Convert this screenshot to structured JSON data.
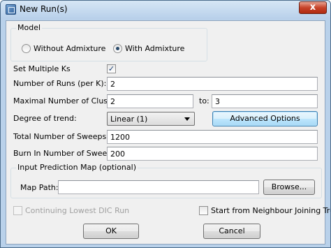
{
  "window": {
    "title": "New Run(s)",
    "close_glyph": "x",
    "icon": "app-window-icon"
  },
  "model": {
    "legend": "Model",
    "options": [
      {
        "label": "Without Admixture",
        "selected": false
      },
      {
        "label": "With Admixture",
        "selected": true
      }
    ]
  },
  "multiple_ks": {
    "label": "Set Multiple Ks",
    "checked": true,
    "check_glyph": "✓"
  },
  "runs": {
    "label": "Number of Runs (per K):",
    "value": "2"
  },
  "clusters": {
    "label": "Maximal Number of Clusters:",
    "value": "2",
    "to_label": "to:",
    "to_value": "3"
  },
  "trend": {
    "label": "Degree of trend:",
    "selected": "Linear (1)",
    "advanced_label": "Advanced Options"
  },
  "sweeps": {
    "label": "Total Number of Sweeps:",
    "value": "1200"
  },
  "burnin": {
    "label": "Burn In Number of Sweeps:",
    "value": "200"
  },
  "prediction_map": {
    "legend": "Input Prediction Map (optional)",
    "path_label": "Map Path:",
    "path_value": "",
    "browse_label": "Browse..."
  },
  "continuing": {
    "label": "Continuing Lowest DIC Run",
    "checked": false,
    "enabled": false
  },
  "neighbour": {
    "label": "Start from Neighbour Joining Tree",
    "checked": false
  },
  "footer": {
    "ok_label": "OK",
    "cancel_label": "Cancel"
  }
}
